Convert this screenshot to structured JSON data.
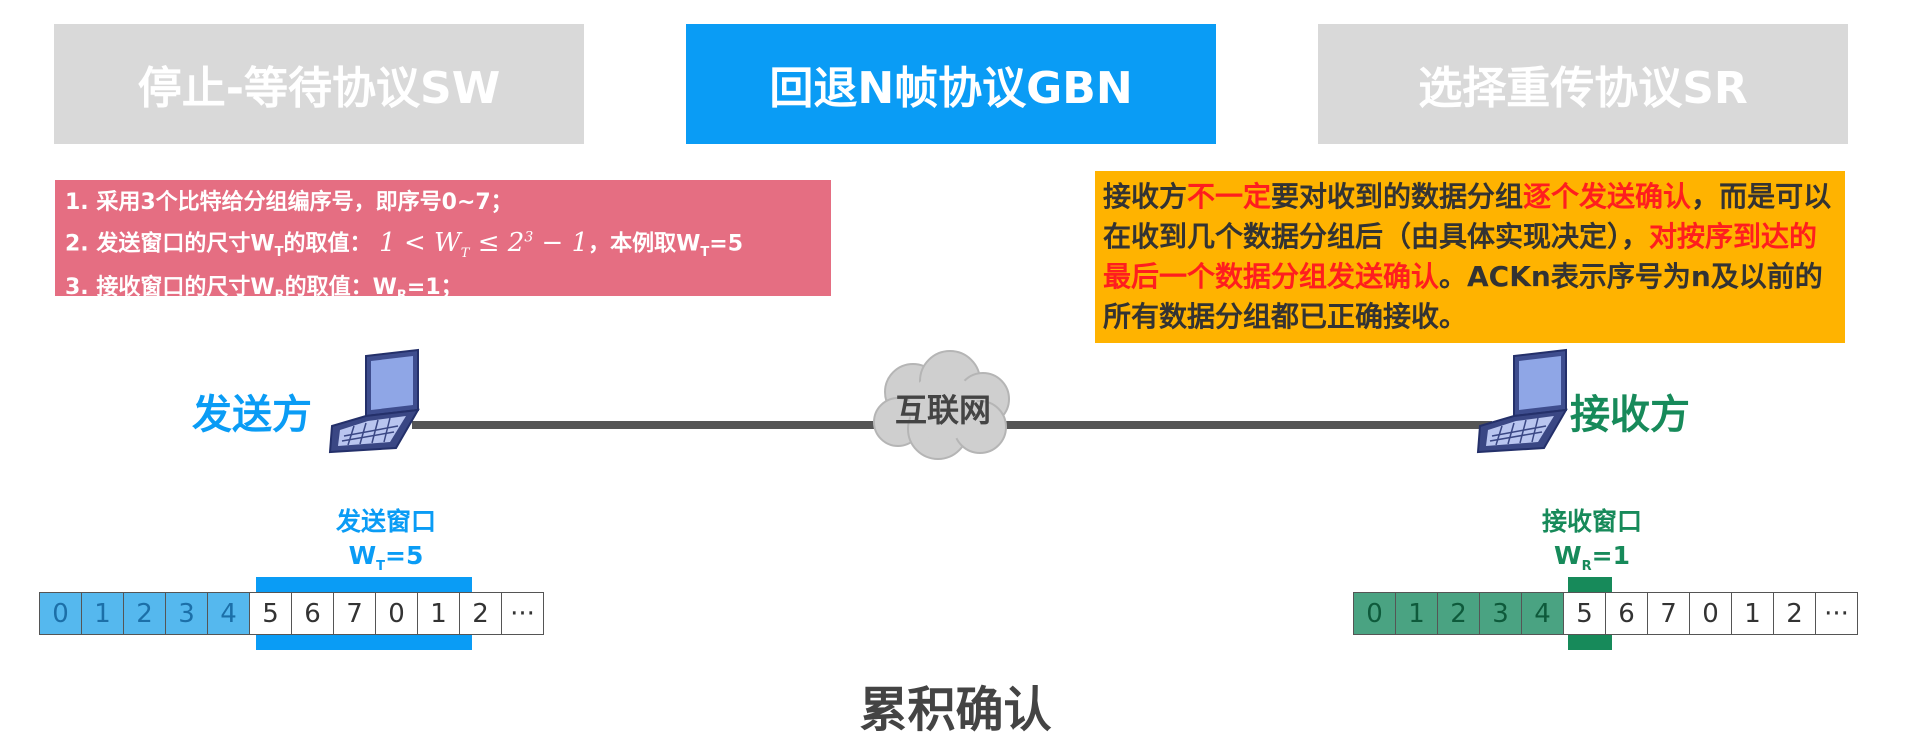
{
  "tabs": [
    {
      "label": "停止-等待协议SW",
      "active": false
    },
    {
      "label": "回退N帧协议GBN",
      "active": true
    },
    {
      "label": "选择重传协议SR",
      "active": false
    }
  ],
  "rules": {
    "line1": "1. 采用3个比特给分组编序号，即序号0~7；",
    "line2_prefix": "2. 发送窗口的尺寸W",
    "line2_sub": "T",
    "line2_mid": "的取值：",
    "line2_math_1": "1",
    "line2_math_lt": "<",
    "line2_math_w": "W",
    "line2_math_wsub": "T",
    "line2_math_le": "≤",
    "line2_math_2": "2",
    "line2_math_exp": "3",
    "line2_math_minus": "−",
    "line2_math_one": "1",
    "line2_tail_1": "，本例取W",
    "line2_tail_sub": "T",
    "line2_tail_2": "=5",
    "line3_prefix": "3. 接收窗口的尺寸W",
    "line3_sub": "R",
    "line3_mid": "的取值：W",
    "line3_sub2": "R",
    "line3_tail": "=1；"
  },
  "note": {
    "p1": "接收方",
    "p2": "不一定",
    "p3": "要对收到的数据分组",
    "p4": "逐个发送确认",
    "p5": "，而是可以在收到几个数据分组后（由具体实现决定），",
    "p6": "对按序到达的最后一个数据分组发送确认",
    "p7": "。ACKn表示序号为n及以前的所有数据分组都已正确接收。"
  },
  "sender": {
    "label": "发送方"
  },
  "receiver": {
    "label": "接收方"
  },
  "network": {
    "label": "互联网"
  },
  "send_window": {
    "title": "发送窗口",
    "size_prefix": "W",
    "size_sub": "T",
    "size_tail": "=5",
    "cells": [
      "0",
      "1",
      "2",
      "3",
      "4",
      "5",
      "6",
      "7",
      "0",
      "1",
      "2",
      "···"
    ],
    "filled_count": 5
  },
  "recv_window": {
    "title": "接收窗口",
    "size_prefix": "W",
    "size_sub": "R",
    "size_tail": "=1",
    "cells": [
      "0",
      "1",
      "2",
      "3",
      "4",
      "5",
      "6",
      "7",
      "0",
      "1",
      "2",
      "···"
    ],
    "filled_count": 5
  },
  "bottom_title": "累积确认",
  "colors": {
    "active_tab": "#0a9cf5",
    "inactive_tab": "#d9d9d9",
    "send_blue": "#0a9cf5",
    "recv_green": "#178a5a",
    "pink": "#e56e82",
    "orange": "#ffb300",
    "emphasis_red": "#ff1e1e"
  }
}
